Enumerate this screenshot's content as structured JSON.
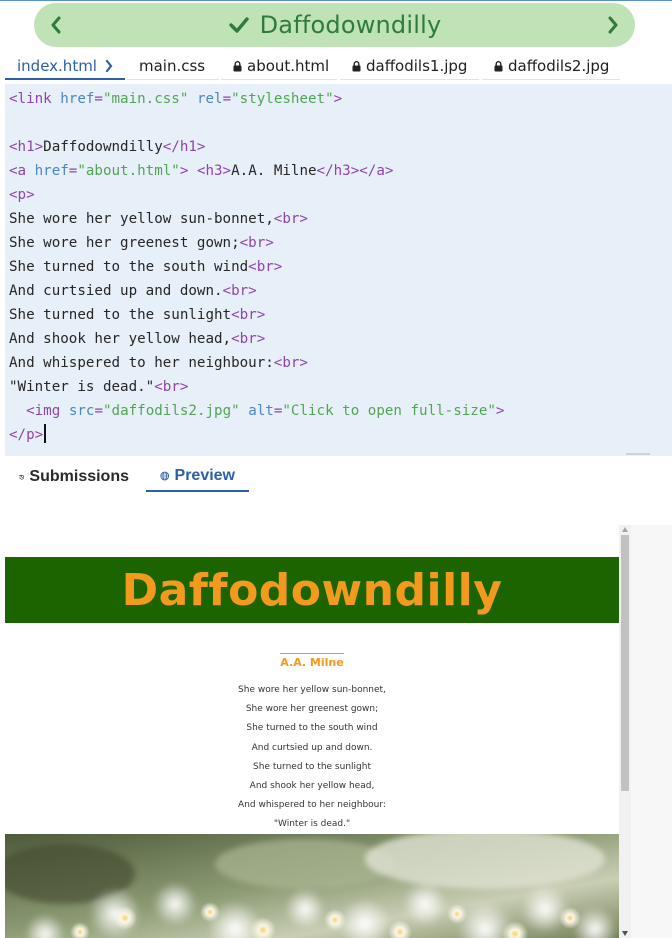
{
  "header": {
    "title": "Daffodowndilly",
    "icons": {
      "prev": "chevron-left-icon",
      "next": "chevron-right-icon",
      "status": "checkmark-icon"
    },
    "colors": {
      "banner": "#bfe3b7",
      "text": "#2f7a3c"
    }
  },
  "file_tabs": [
    {
      "label": "index.html",
      "locked": false,
      "active": true
    },
    {
      "label": "main.css",
      "locked": false,
      "active": false
    },
    {
      "label": "about.html",
      "locked": true,
      "active": false
    },
    {
      "label": "daffodils1.jpg",
      "locked": true,
      "active": false
    },
    {
      "label": "daffodils2.jpg",
      "locked": true,
      "active": false
    }
  ],
  "editor": {
    "lines": [
      [
        [
          "tg",
          "<link "
        ],
        [
          "at",
          "href"
        ],
        [
          "tg",
          "="
        ],
        [
          "st",
          "\"main.css\""
        ],
        [
          "tx",
          " "
        ],
        [
          "at",
          "rel"
        ],
        [
          "tg",
          "="
        ],
        [
          "st",
          "\"stylesheet\""
        ],
        [
          "tg",
          ">"
        ]
      ],
      [],
      [
        [
          "tg",
          "<h1>"
        ],
        [
          "tx",
          "Daffodowndilly"
        ],
        [
          "tg",
          "</h1>"
        ]
      ],
      [
        [
          "tg",
          "<a "
        ],
        [
          "at",
          "href"
        ],
        [
          "tg",
          "="
        ],
        [
          "st",
          "\"about.html\""
        ],
        [
          "tg",
          ">"
        ],
        [
          "tx",
          " "
        ],
        [
          "tg",
          "<h3>"
        ],
        [
          "tx",
          "A.A. Milne"
        ],
        [
          "tg",
          "</h3></a>"
        ]
      ],
      [
        [
          "tg",
          "<p>"
        ]
      ],
      [
        [
          "tx",
          "She wore her yellow sun-bonnet,"
        ],
        [
          "tg",
          "<br>"
        ]
      ],
      [
        [
          "tx",
          "She wore her greenest gown;"
        ],
        [
          "tg",
          "<br>"
        ]
      ],
      [
        [
          "tx",
          "She turned to the south wind"
        ],
        [
          "tg",
          "<br>"
        ]
      ],
      [
        [
          "tx",
          "And curtsied up and down."
        ],
        [
          "tg",
          "<br>"
        ]
      ],
      [
        [
          "tx",
          "She turned to the sunlight"
        ],
        [
          "tg",
          "<br>"
        ]
      ],
      [
        [
          "tx",
          "And shook her yellow head,"
        ],
        [
          "tg",
          "<br>"
        ]
      ],
      [
        [
          "tx",
          "And whispered to her neighbour:"
        ],
        [
          "tg",
          "<br>"
        ]
      ],
      [
        [
          "tx",
          "\"Winter is dead.\""
        ],
        [
          "tg",
          "<br>"
        ]
      ],
      [
        [
          "tx",
          "  "
        ],
        [
          "tg",
          "<img "
        ],
        [
          "at",
          "src"
        ],
        [
          "tg",
          "="
        ],
        [
          "st",
          "\"daffodils2.jpg\""
        ],
        [
          "tx",
          " "
        ],
        [
          "at",
          "alt"
        ],
        [
          "tg",
          "="
        ],
        [
          "st",
          "\"Click to open full-size\""
        ],
        [
          "tg",
          ">"
        ]
      ],
      [
        [
          "tg",
          "</p>"
        ]
      ]
    ],
    "colors": {
      "background": "#e7f0f9",
      "tag": "#8e44ad",
      "attribute": "#4a86c8",
      "string": "#52a553",
      "text": "#262626"
    }
  },
  "bottom_tabs": {
    "submissions": {
      "label": "Submissions",
      "icon": "history-icon"
    },
    "preview": {
      "label": "Preview",
      "icon": "globe-icon",
      "active": true
    }
  },
  "preview": {
    "title": "Daffodowndilly",
    "author": "A.A. Milne",
    "poem_lines": [
      "She wore her yellow sun-bonnet,",
      "She wore her greenest gown;",
      "She turned to the south wind",
      "And curtsied up and down.",
      "She turned to the sunlight",
      "And shook her yellow head,",
      "And whispered to her neighbour:",
      "\"Winter is dead.\""
    ],
    "image_icon": "daffodils-photo",
    "colors": {
      "header_bg": "#1c6400",
      "title": "#f39a1e",
      "author": "#f39a1e"
    }
  }
}
